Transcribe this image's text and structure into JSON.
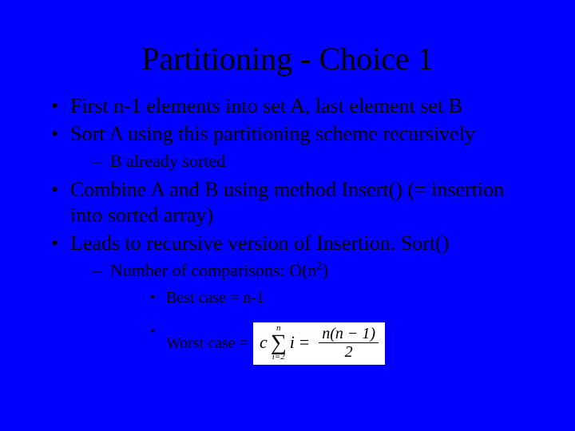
{
  "title": "Partitioning - Choice 1",
  "bullets": {
    "b1": "First n-1 elements into set A, last element set B",
    "b2": "Sort A using this partitioning scheme recursively",
    "b2_1": "B already sorted",
    "b3": "Combine A and B using method Insert() (= insertion into sorted array)",
    "b4": "Leads to recursive version of Insertion. Sort()",
    "b4_1_pre": "Number of comparisons: O(n",
    "b4_1_exp": "2",
    "b4_1_post": ")",
    "b4_1_1": "Best case = n-1",
    "b4_1_2": "Worst case ="
  },
  "formula": {
    "c": "c",
    "upper": "n",
    "lower": "i=2",
    "term": "i",
    "eq": "=",
    "num_a": "n",
    "num_b": "(n − 1)",
    "den": "2"
  }
}
